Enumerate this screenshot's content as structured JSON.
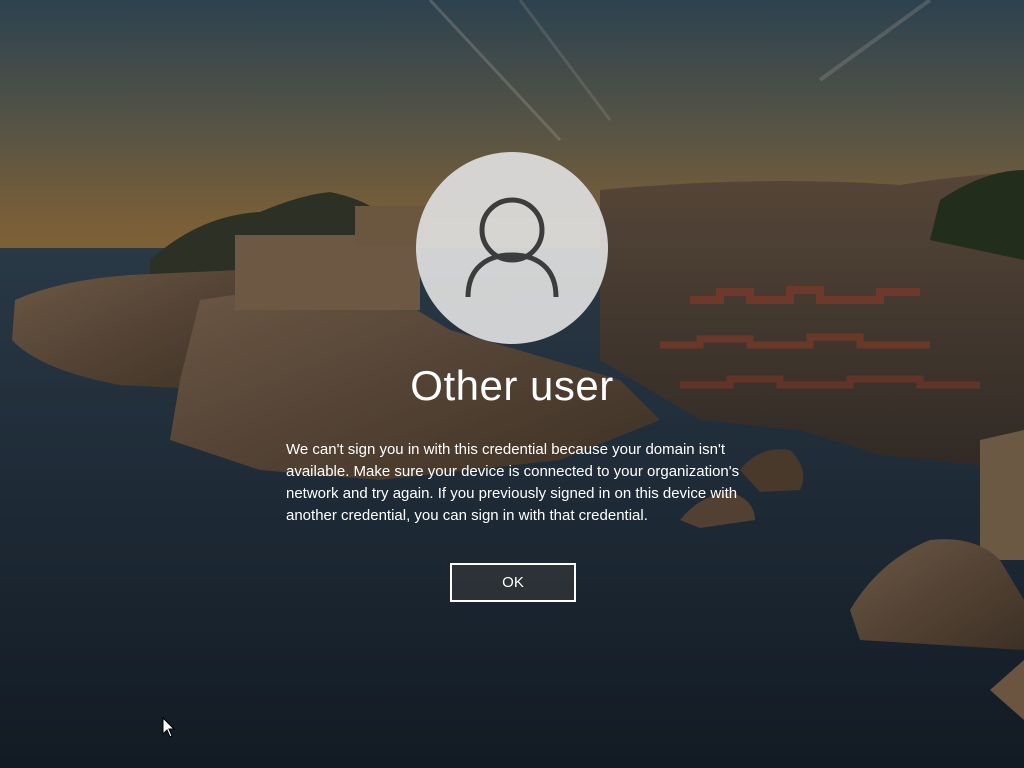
{
  "login": {
    "user_name": "Other user",
    "message": "We can't sign you in with this credential because your domain isn't available. Make sure your device is connected to your organization's network and try again. If you previously signed in on this device with another credential, you can sign in with that credential.",
    "ok_label": "OK",
    "avatar_icon": "user-silhouette-icon"
  },
  "colors": {
    "text": "#ffffff",
    "avatar_bg": "#dedede",
    "avatar_glyph": "#3c3c3c",
    "button_border": "#ffffff"
  }
}
